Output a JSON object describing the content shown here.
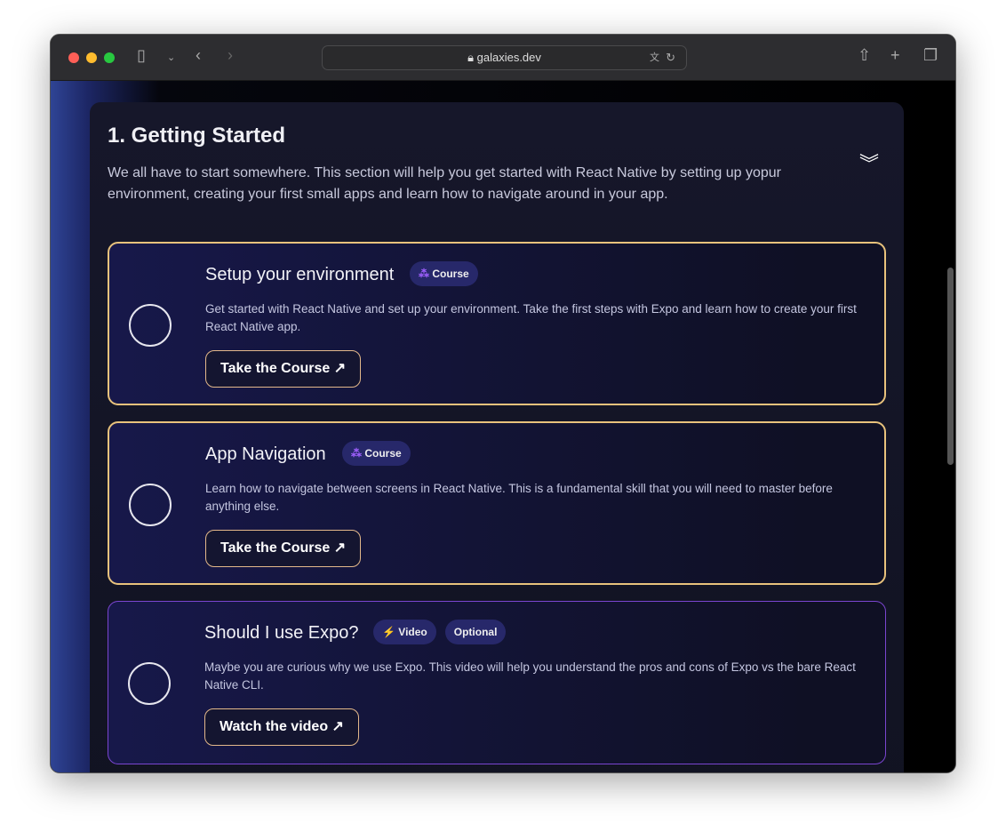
{
  "browser": {
    "url": "galaxies.dev"
  },
  "section": {
    "title": "1. Getting Started",
    "intro": "We all have to start somewhere. This section will help you get started with React Native by setting up yopur environment, creating your first small apps and learn how to navigate around in your app."
  },
  "cards": [
    {
      "title": "Setup your environment",
      "badges": [
        "Course"
      ],
      "description": "Get started with React Native and set up your environment. Take the first steps with Expo and learn how to create your first React Native app.",
      "button": "Take the Course",
      "border_color": "#e8c27c"
    },
    {
      "title": "App Navigation",
      "badges": [
        "Course"
      ],
      "description": "Learn how to navigate between screens in React Native. This is a fundamental skill that you will need to master before anything else.",
      "button": "Take the Course",
      "border_color": "#e8c27c"
    },
    {
      "title": "Should I use Expo?",
      "badges": [
        "Video",
        "Optional"
      ],
      "description": "Maybe you are curious why we use Expo. This video will help you understand the pros and cons of Expo vs the bare React Native CLI.",
      "button": "Watch the video",
      "border_color": "#7a45d0"
    }
  ]
}
